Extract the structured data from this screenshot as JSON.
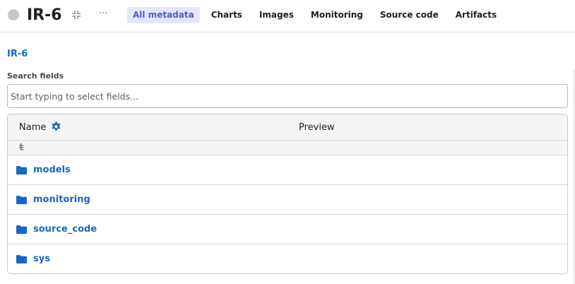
{
  "header": {
    "status_color": "#c6c6c6",
    "title": "IR-6",
    "collapse_icon": "collapse-arrows-icon",
    "more_icon": "ellipsis-icon",
    "more_glyph": "···",
    "tabs": [
      {
        "label": "All metadata",
        "active": true
      },
      {
        "label": "Charts",
        "active": false
      },
      {
        "label": "Images",
        "active": false
      },
      {
        "label": "Monitoring",
        "active": false
      },
      {
        "label": "Source code",
        "active": false
      },
      {
        "label": "Artifacts",
        "active": false
      }
    ]
  },
  "breadcrumb": "IR-6",
  "search": {
    "label": "Search fields",
    "placeholder": "Start typing to select fields...",
    "value": ""
  },
  "table": {
    "columns": {
      "name": "Name",
      "preview": "Preview"
    },
    "name_settings_icon": "gear-icon",
    "up_icon": "up-level-icon",
    "up_glyph": "ŧ",
    "rows": [
      {
        "label": "models",
        "icon": "folder-icon"
      },
      {
        "label": "monitoring",
        "icon": "folder-icon"
      },
      {
        "label": "source_code",
        "icon": "folder-icon"
      },
      {
        "label": "sys",
        "icon": "folder-icon"
      }
    ]
  },
  "colors": {
    "accent_link": "#1967c4",
    "active_tab_bg": "#e4e7fb",
    "active_tab_text": "#4a5bd0"
  }
}
